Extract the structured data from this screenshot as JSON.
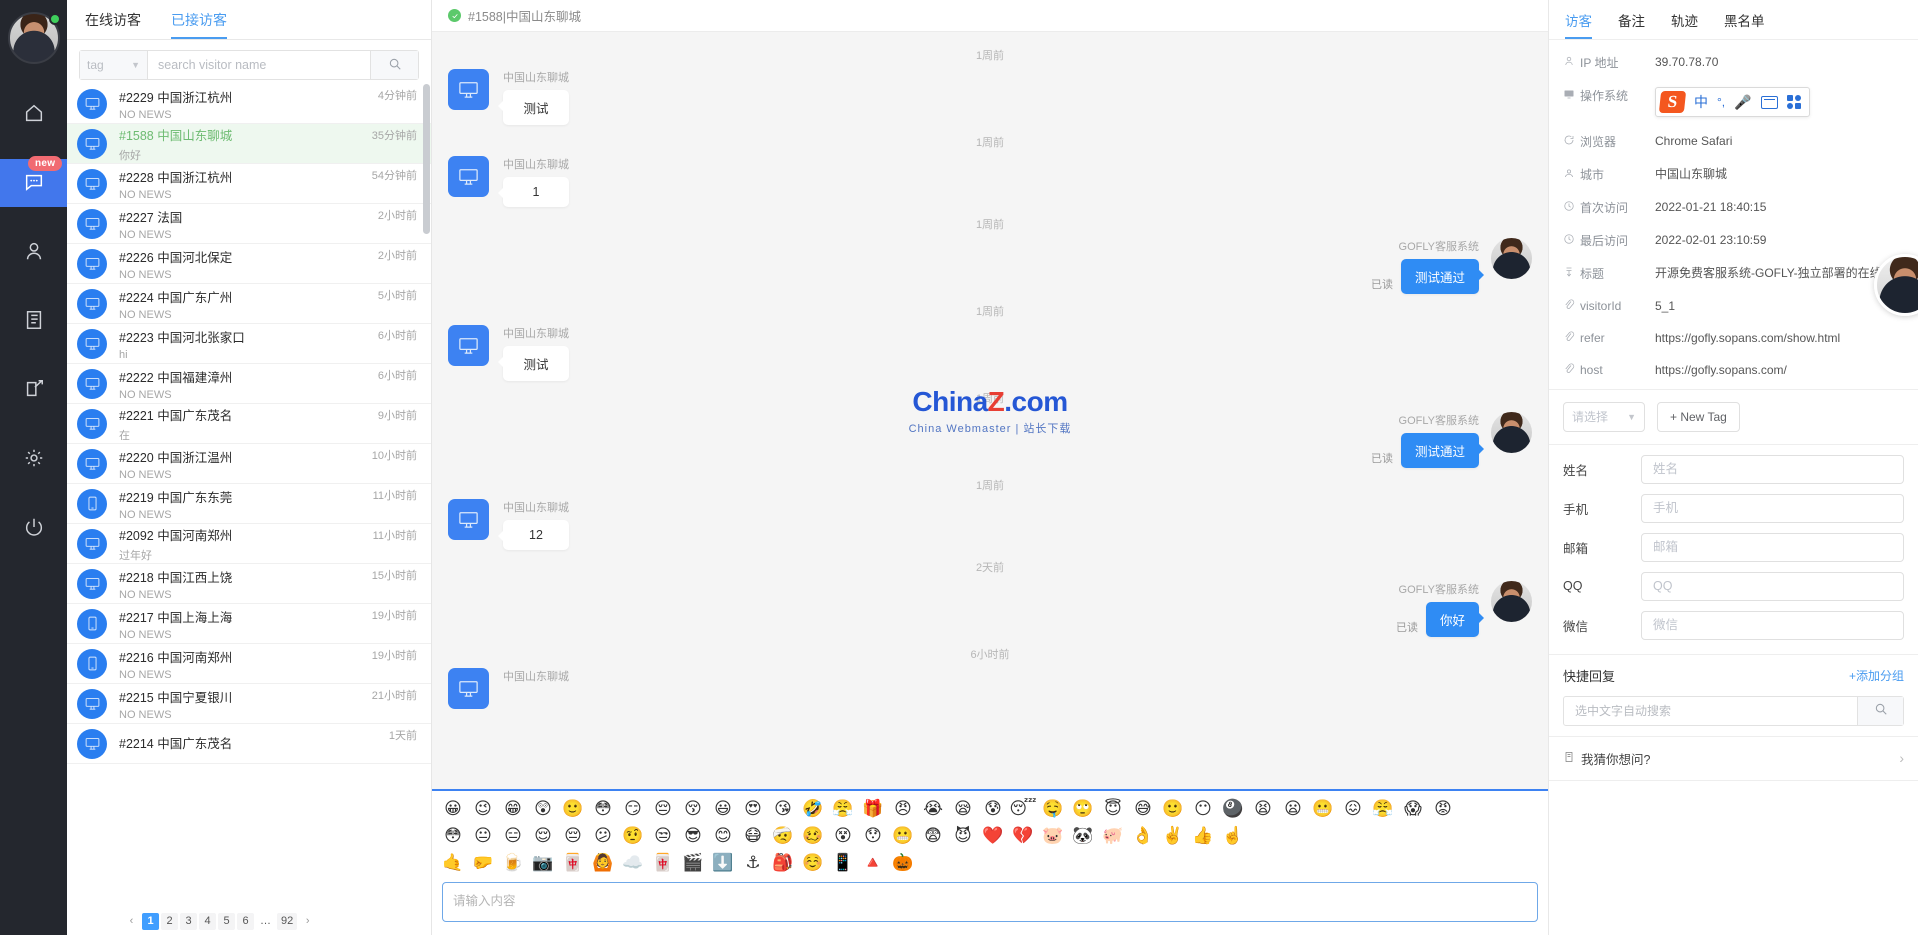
{
  "rail": {
    "avatar": "agent-avatar",
    "status": "online",
    "badge": "new",
    "items": [
      {
        "icon": "home-icon",
        "name": "home",
        "active": false
      },
      {
        "icon": "chat-icon",
        "name": "chat",
        "active": true
      },
      {
        "icon": "user-icon",
        "name": "users",
        "active": false
      },
      {
        "icon": "list-icon",
        "name": "records",
        "active": false
      },
      {
        "icon": "edit-icon",
        "name": "compose",
        "active": false
      },
      {
        "icon": "gear-icon",
        "name": "settings",
        "active": false
      },
      {
        "icon": "power-icon",
        "name": "logout",
        "active": false
      }
    ]
  },
  "visitor_panel": {
    "tabs": [
      {
        "label": "在线访客",
        "active": false
      },
      {
        "label": "已接访客",
        "active": true
      }
    ],
    "tag_filter": "tag",
    "search_placeholder": "search visitor name",
    "search_value": "",
    "rows": [
      {
        "name": "#2229 中国浙江杭州",
        "msg": "NO NEWS",
        "time": "4分钟前",
        "device": "desktop",
        "active": false
      },
      {
        "name": "#1588 中国山东聊城",
        "msg": "你好",
        "time": "35分钟前",
        "device": "desktop",
        "active": true
      },
      {
        "name": "#2228 中国浙江杭州",
        "msg": "NO NEWS",
        "time": "54分钟前",
        "device": "desktop",
        "active": false
      },
      {
        "name": "#2227 法国",
        "msg": "NO NEWS",
        "time": "2小时前",
        "device": "desktop",
        "active": false
      },
      {
        "name": "#2226 中国河北保定",
        "msg": "NO NEWS",
        "time": "2小时前",
        "device": "desktop",
        "active": false
      },
      {
        "name": "#2224 中国广东广州",
        "msg": "NO NEWS",
        "time": "5小时前",
        "device": "desktop",
        "active": false
      },
      {
        "name": "#2223 中国河北张家口",
        "msg": "hi",
        "time": "6小时前",
        "device": "desktop",
        "active": false
      },
      {
        "name": "#2222 中国福建漳州",
        "msg": "NO NEWS",
        "time": "6小时前",
        "device": "desktop",
        "active": false
      },
      {
        "name": "#2221 中国广东茂名",
        "msg": "在",
        "time": "9小时前",
        "device": "desktop",
        "active": false
      },
      {
        "name": "#2220 中国浙江温州",
        "msg": "NO NEWS",
        "time": "10小时前",
        "device": "desktop",
        "active": false
      },
      {
        "name": "#2219 中国广东东莞",
        "msg": "NO NEWS",
        "time": "11小时前",
        "device": "mobile",
        "active": false
      },
      {
        "name": "#2092 中国河南郑州",
        "msg": "过年好",
        "time": "11小时前",
        "device": "desktop",
        "active": false
      },
      {
        "name": "#2218 中国江西上饶",
        "msg": "NO NEWS",
        "time": "15小时前",
        "device": "desktop",
        "active": false
      },
      {
        "name": "#2217 中国上海上海",
        "msg": "NO NEWS",
        "time": "19小时前",
        "device": "mobile",
        "active": false
      },
      {
        "name": "#2216 中国河南郑州",
        "msg": "NO NEWS",
        "time": "19小时前",
        "device": "mobile",
        "active": false
      },
      {
        "name": "#2215 中国宁夏银川",
        "msg": "NO NEWS",
        "time": "21小时前",
        "device": "desktop",
        "active": false
      },
      {
        "name": "#2214 中国广东茂名",
        "msg": "",
        "time": "1天前",
        "device": "desktop",
        "active": false
      }
    ],
    "pagination": {
      "prev": "‹",
      "next": "›",
      "pages": [
        "1",
        "2",
        "3",
        "4",
        "5",
        "6",
        "…",
        "92"
      ],
      "current": "1"
    }
  },
  "chat": {
    "header_title": "#1588|中国山东聊城",
    "watermark": {
      "c": "China",
      "z": "Z",
      "dot": ".com",
      "sub": "China Webmaster | 站长下载"
    },
    "messages": [
      {
        "ts": "1周前",
        "side": "in",
        "who": "中国山东聊城",
        "text": "测试",
        "read": ""
      },
      {
        "ts": "1周前",
        "side": "in",
        "who": "中国山东聊城",
        "text": "1",
        "read": ""
      },
      {
        "ts": "1周前",
        "side": "out",
        "who": "GOFLY客服系统",
        "text": "测试通过",
        "read": "已读"
      },
      {
        "ts": "1周前",
        "side": "in",
        "who": "中国山东聊城",
        "text": "测试",
        "read": ""
      },
      {
        "ts": "1周前",
        "side": "out",
        "who": "GOFLY客服系统",
        "text": "测试通过",
        "read": "已读"
      },
      {
        "ts": "1周前",
        "side": "in",
        "who": "中国山东聊城",
        "text": "12",
        "read": ""
      },
      {
        "ts": "2天前",
        "side": "out",
        "who": "GOFLY客服系统",
        "text": "你好",
        "read": "已读"
      },
      {
        "ts": "6小时前",
        "side": "in",
        "who": "中国山东聊城",
        "text": "",
        "read": ""
      }
    ],
    "emoji_rows": [
      [
        "😀",
        "😉",
        "😁",
        "😲",
        "🙂",
        "😳",
        "😏",
        "😔",
        "😚",
        "😃",
        "😍",
        "😘",
        "🤣",
        "😤",
        "🎁",
        "😠",
        "😭",
        "😪",
        "😰",
        "😴",
        "🤤",
        "🙄",
        "😇",
        "😅",
        "🙂",
        "😶",
        "🎱",
        "😫",
        "😦",
        "😬",
        "😖",
        "😤",
        "😱",
        "😡"
      ],
      [
        "😳",
        "😐",
        "😑",
        "😌",
        "😔",
        "😕",
        "🤨",
        "😒",
        "😎",
        "😊",
        "😷",
        "🤕",
        "🥴",
        "😵",
        "😯",
        "😬",
        "😨",
        "😈",
        "❤️",
        "💔",
        "🐷",
        "🐼",
        "🐖",
        "👌",
        "✌️",
        "👍",
        "☝️"
      ],
      [
        "🤙",
        "🤛",
        "🍺",
        "📷",
        "🀄",
        "🙆",
        "☁️",
        "🀄",
        "🎬",
        "⬇️",
        "⚓",
        "🎒",
        "☺️",
        "📱",
        "🔺",
        "🎃"
      ]
    ],
    "composer_placeholder": "请输入内容",
    "composer_value": ""
  },
  "right_panel": {
    "tabs": [
      {
        "label": "访客",
        "active": true
      },
      {
        "label": "备注",
        "active": false
      },
      {
        "label": "轨迹",
        "active": false
      },
      {
        "label": "黑名单",
        "active": false
      }
    ],
    "info": [
      {
        "icon": "user-icon",
        "label": "IP 地址",
        "value": "39.70.78.70"
      },
      {
        "icon": "monitor-icon",
        "label": "操作系统",
        "value": "",
        "ime": true
      },
      {
        "icon": "browser-icon",
        "label": "浏览器",
        "value": "Chrome Safari"
      },
      {
        "icon": "city-icon",
        "label": "城市",
        "value": "中国山东聊城"
      },
      {
        "icon": "clock-icon",
        "label": "首次访问",
        "value": "2022-01-21 18:40:15"
      },
      {
        "icon": "clock-icon",
        "label": "最后访问",
        "value": "2022-02-01 23:10:59"
      },
      {
        "icon": "tag-icon",
        "label": "标题",
        "value": "开源免费客服系统-GOFLY-独立部署的在线客服系统源"
      },
      {
        "icon": "link-icon",
        "label": "visitorId",
        "value": "5_1"
      },
      {
        "icon": "link-icon",
        "label": "refer",
        "value": "https://gofly.sopans.com/show.html"
      },
      {
        "icon": "link-icon",
        "label": "host",
        "value": "https://gofly.sopans.com/"
      }
    ],
    "ime_bar": {
      "logo": "S",
      "items": [
        "中",
        "°,",
        "mic-icon",
        "keyboard-icon",
        "grid-icon"
      ]
    },
    "tag_select_placeholder": "请选择",
    "new_tag_label": "+ New Tag",
    "form": [
      {
        "label": "姓名",
        "placeholder": "姓名",
        "value": ""
      },
      {
        "label": "手机",
        "placeholder": "手机",
        "value": ""
      },
      {
        "label": "邮箱",
        "placeholder": "邮箱",
        "value": ""
      },
      {
        "label": "QQ",
        "placeholder": "QQ",
        "value": ""
      },
      {
        "label": "微信",
        "placeholder": "微信",
        "value": ""
      }
    ],
    "quick_reply": {
      "title": "快捷回复",
      "add_group": "+添加分组",
      "search_placeholder": "选中文字自动搜索",
      "search_value": "",
      "guess_label": "我猜你想问?"
    }
  },
  "colors": {
    "accent": "#409eff",
    "bubble_blue": "#2f8cf4",
    "rail_bg": "#24272e",
    "active_row": "#eef8ef",
    "badge_red": "#f16b72",
    "online_green": "#3fcf5c"
  }
}
